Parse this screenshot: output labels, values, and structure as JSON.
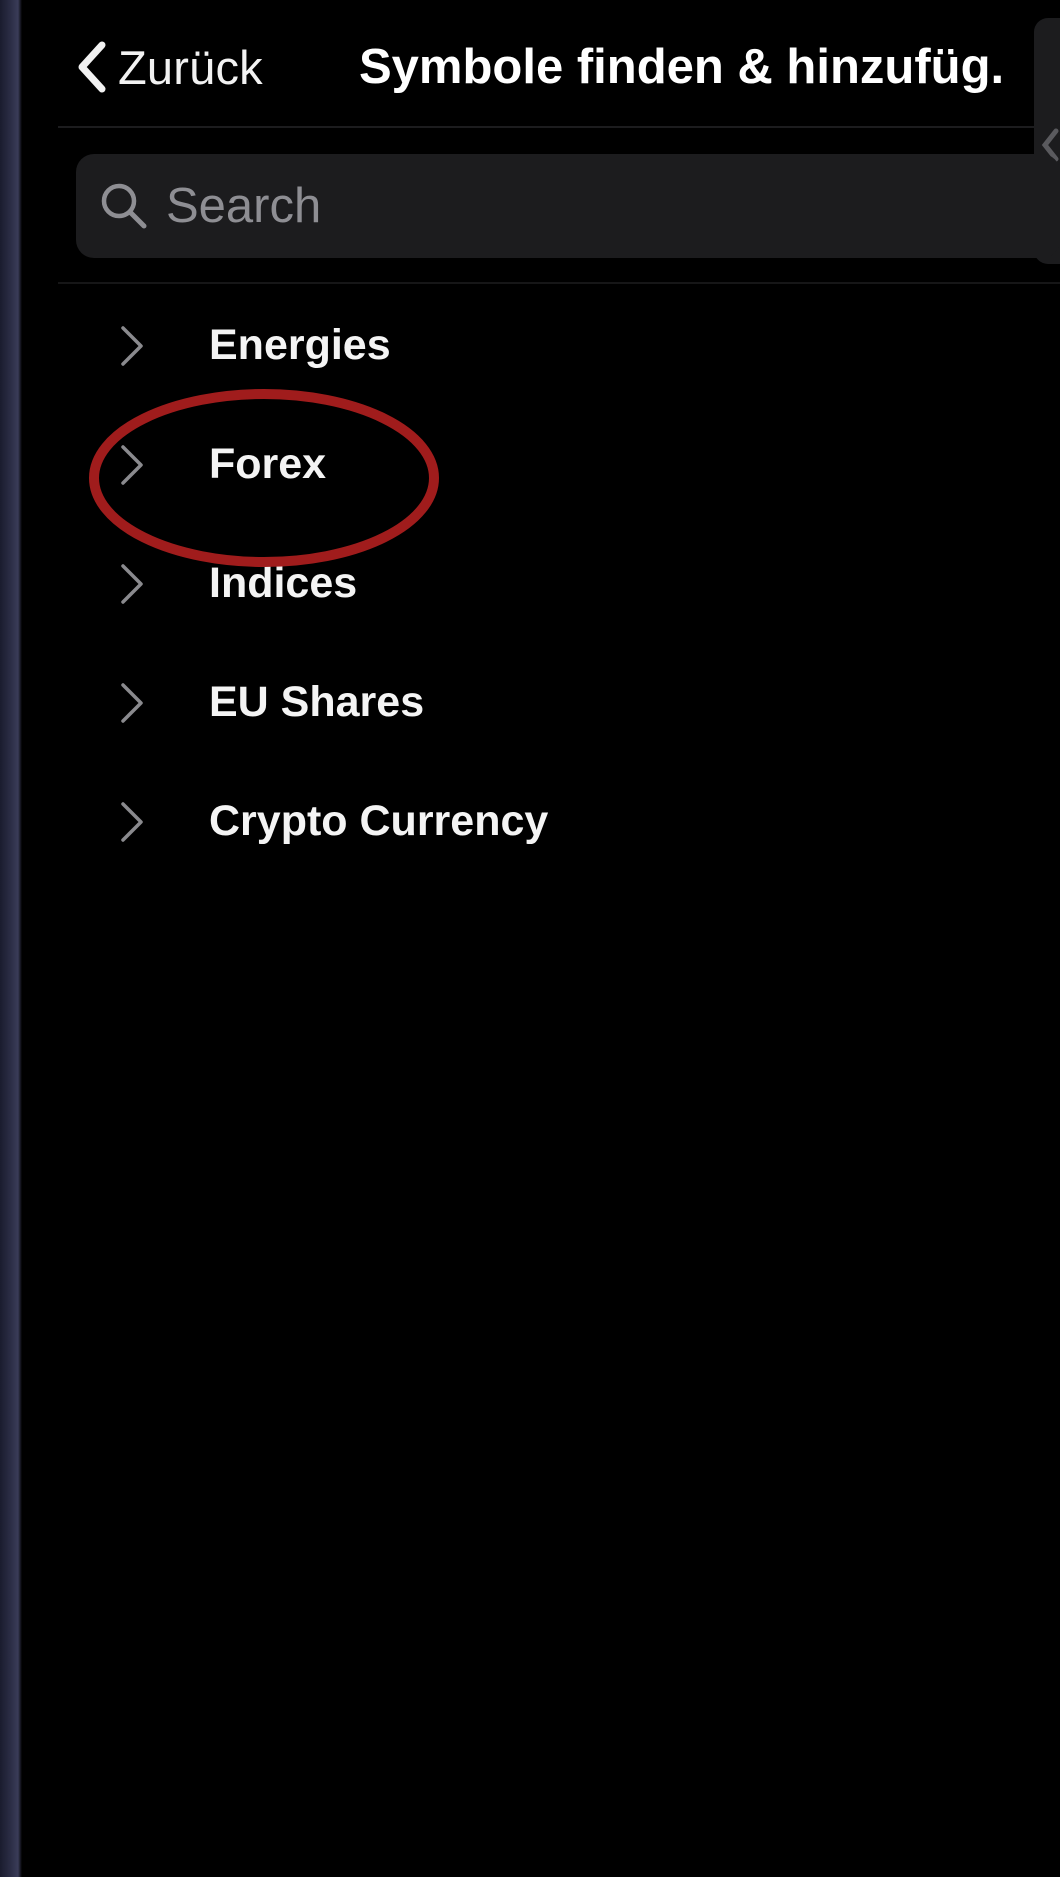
{
  "nav": {
    "back_label": "Zurück",
    "title": "Symbole finden & hinzufüg."
  },
  "search": {
    "placeholder": "Search",
    "value": ""
  },
  "categories": [
    {
      "label": "Energies"
    },
    {
      "label": "Forex"
    },
    {
      "label": "Indices"
    },
    {
      "label": "EU Shares"
    },
    {
      "label": "Crypto Currency"
    }
  ],
  "annotation": {
    "highlighted_item": "Forex",
    "color": "#a01c1c"
  },
  "colors": {
    "background": "#000000",
    "surface": "#1c1c1e",
    "text": "#ffffff",
    "placeholder": "#8e8e93",
    "chevron": "#8a8a8e"
  },
  "icons": {
    "back": "chevron-left-icon",
    "search": "search-icon",
    "row": "chevron-right-icon"
  }
}
